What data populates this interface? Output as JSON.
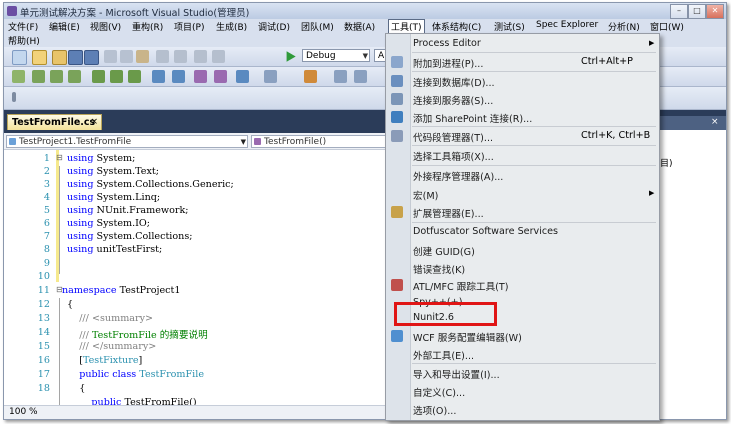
{
  "window": {
    "title": "单元测试解决方案 - Microsoft Visual Studio(管理员)",
    "controls": [
      "–",
      "□",
      "✕"
    ]
  },
  "menubar": {
    "items": [
      "文件(F)",
      "编辑(E)",
      "视图(V)",
      "重构(R)",
      "项目(P)",
      "生成(B)",
      "调试(D)",
      "团队(M)",
      "数据(A)",
      "工具(T)",
      "体系结构(C)",
      "测试(S)",
      "Spec Explorer",
      "分析(N)",
      "窗口(W)"
    ],
    "help": "帮助(H)",
    "active": "工具(T)"
  },
  "toolbar": {
    "config": "Debug",
    "platform": "A"
  },
  "document": {
    "tab": "TestFromFile.cs",
    "tab_close": "×",
    "nav_class": "TestProject1.TestFromFile",
    "nav_member": "TestFromFile()",
    "zoom": "100 %"
  },
  "code": {
    "line_numbers": [
      "1",
      "2",
      "3",
      "4",
      "5",
      "6",
      "7",
      "8",
      "9",
      "10",
      "11",
      "12",
      "13",
      "14",
      "15",
      "16",
      "17",
      "18"
    ]
  },
  "right_panel": {
    "partial_text": "目)",
    "close": "×"
  },
  "tools_menu": {
    "items": [
      {
        "label": "Process Editor",
        "shortcut": "",
        "submenu": true
      },
      {
        "label": "附加到进程(P)...",
        "shortcut": "Ctrl+Alt+P",
        "submenu": false
      },
      {
        "label": "连接到数据库(D)...",
        "shortcut": "",
        "submenu": false
      },
      {
        "label": "连接到服务器(S)...",
        "shortcut": "",
        "submenu": false
      },
      {
        "label": "添加 SharePoint 连接(R)...",
        "shortcut": "",
        "submenu": false
      },
      {
        "label": "代码段管理器(T)...",
        "shortcut": "Ctrl+K, Ctrl+B",
        "submenu": false
      },
      {
        "label": "选择工具箱项(X)...",
        "shortcut": "",
        "submenu": false
      },
      {
        "label": "外接程序管理器(A)...",
        "shortcut": "",
        "submenu": false
      },
      {
        "label": "宏(M)",
        "shortcut": "",
        "submenu": true
      },
      {
        "label": "扩展管理器(E)...",
        "shortcut": "",
        "submenu": false
      },
      {
        "label": "Dotfuscator Software Services",
        "shortcut": "",
        "submenu": false
      },
      {
        "label": "创建 GUID(G)",
        "shortcut": "",
        "submenu": false
      },
      {
        "label": "错误查找(K)",
        "shortcut": "",
        "submenu": false
      },
      {
        "label": "ATL/MFC 跟踪工具(T)",
        "shortcut": "",
        "submenu": false
      },
      {
        "label": "Spy++(+)",
        "shortcut": "",
        "submenu": false
      },
      {
        "label": "Nunit2.6",
        "shortcut": "",
        "submenu": false
      },
      {
        "label": "WCF 服务配置编辑器(W)",
        "shortcut": "",
        "submenu": false
      },
      {
        "label": "外部工具(E)...",
        "shortcut": "",
        "submenu": false
      },
      {
        "label": "导入和导出设置(I)...",
        "shortcut": "",
        "submenu": false
      },
      {
        "label": "自定义(C)...",
        "shortcut": "",
        "submenu": false
      },
      {
        "label": "选项(O)...",
        "shortcut": "",
        "submenu": false
      }
    ]
  },
  "colors": {
    "highlight_box": "#e01515",
    "keyword": "#0000ff",
    "comment": "#008000",
    "type": "#2b91af"
  }
}
